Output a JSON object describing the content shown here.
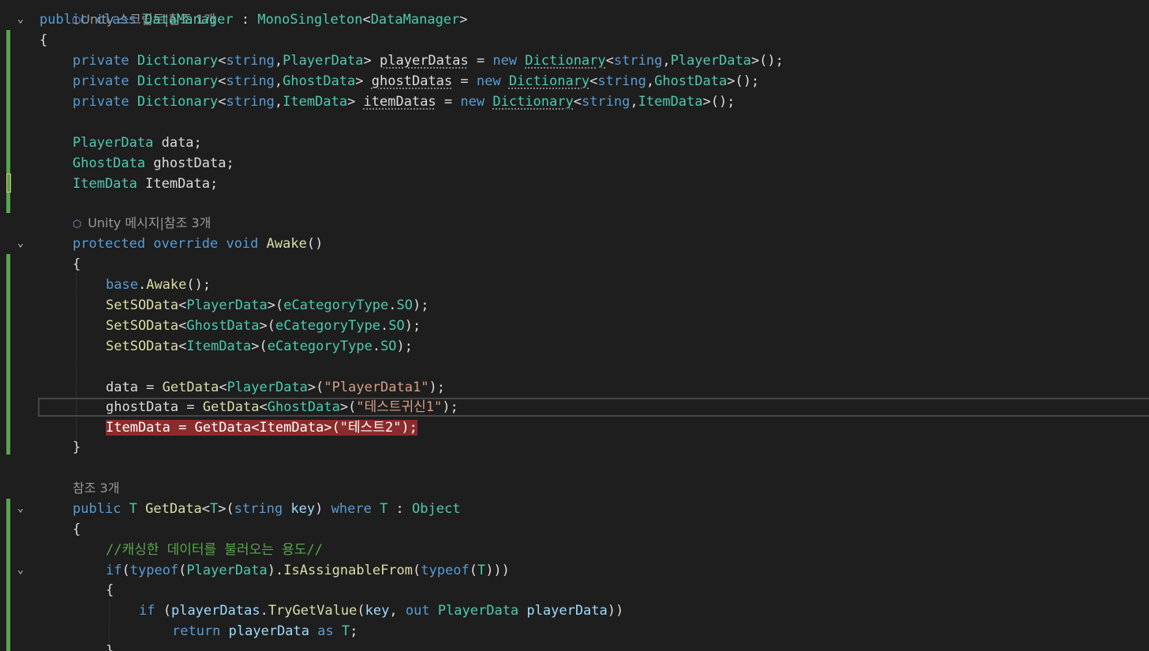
{
  "editor": {
    "lens_top": "Unity 스크립트|참조 1개",
    "lines": {
      "l1": [
        "public class ",
        "DataManager",
        " : ",
        "MonoSingleton",
        "<",
        "DataManager",
        ">"
      ],
      "l2": "{",
      "l3": [
        "private ",
        "Dictionary",
        "<",
        "string",
        ",",
        "PlayerData",
        "> ",
        "playerDatas",
        " = ",
        "new ",
        "Dictionary",
        "<",
        "string",
        ",",
        "PlayerData",
        ">();"
      ],
      "l4": [
        "private ",
        "Dictionary",
        "<",
        "string",
        ",",
        "GhostData",
        "> ",
        "ghostDatas",
        " = ",
        "new ",
        "Dictionary",
        "<",
        "string",
        ",",
        "GhostData",
        ">();"
      ],
      "l5": [
        "private ",
        "Dictionary",
        "<",
        "string",
        ",",
        "ItemData",
        "> ",
        "itemDatas",
        " = ",
        "new ",
        "Dictionary",
        "<",
        "string",
        ",",
        "ItemData",
        ">();"
      ],
      "l7": [
        "PlayerData",
        " data;"
      ],
      "l8": [
        "GhostData",
        " ghostData;"
      ],
      "l9": [
        "ItemData",
        " ItemData;"
      ],
      "lens_awake": "Unity 메시지|참조 3개",
      "l11": [
        "protected override void ",
        "Awake",
        "()"
      ],
      "l12": "{",
      "l13": [
        "base",
        ".",
        "Awake",
        "();"
      ],
      "l14": [
        "SetSOData",
        "<",
        "PlayerData",
        ">(",
        "eCategoryType",
        ".",
        "SO",
        ");"
      ],
      "l15": [
        "SetSOData",
        "<",
        "GhostData",
        ">(",
        "eCategoryType",
        ".",
        "SO",
        ");"
      ],
      "l16": [
        "SetSOData",
        "<",
        "ItemData",
        ">(",
        "eCategoryType",
        ".",
        "SO",
        ");"
      ],
      "l18": [
        "data = ",
        "GetData",
        "<",
        "PlayerData",
        ">(",
        "\"PlayerData1\"",
        ");"
      ],
      "l19": [
        "ghostData = ",
        "GetData",
        "<",
        "GhostData",
        ">(",
        "\"테스트귀신1\"",
        ");"
      ],
      "l20": "ItemData = GetData<ItemData>(\"테스트2\");",
      "l21": "}",
      "lens_getdata": "참조 3개",
      "l23": [
        "public ",
        "T ",
        "GetData",
        "<",
        "T",
        ">(",
        "string ",
        "key",
        ") ",
        "where ",
        "T",
        " : ",
        "Object"
      ],
      "l24": "{",
      "l25": "//캐싱한 데이터를 불러오는 용도//",
      "l26": [
        "if",
        "(",
        "typeof",
        "(",
        "PlayerData",
        ").",
        "IsAssignableFrom",
        "(",
        "typeof",
        "(",
        "T",
        ")))"
      ],
      "l27": "{",
      "l28": [
        "if ",
        "(",
        "playerDatas",
        ".",
        "TryGetValue",
        "(",
        "key",
        ", ",
        "out ",
        "PlayerData ",
        "playerData",
        "))"
      ],
      "l29": [
        "return ",
        "playerData ",
        "as ",
        "T",
        ";"
      ],
      "l30": "}"
    },
    "colors": {
      "background": "#1e1e1e",
      "keyword": "#569cd6",
      "type": "#4ec9b0",
      "method": "#dcdcaa",
      "string": "#d69d85",
      "comment": "#57a64a",
      "breakpoint": "#8b2b2b"
    }
  }
}
